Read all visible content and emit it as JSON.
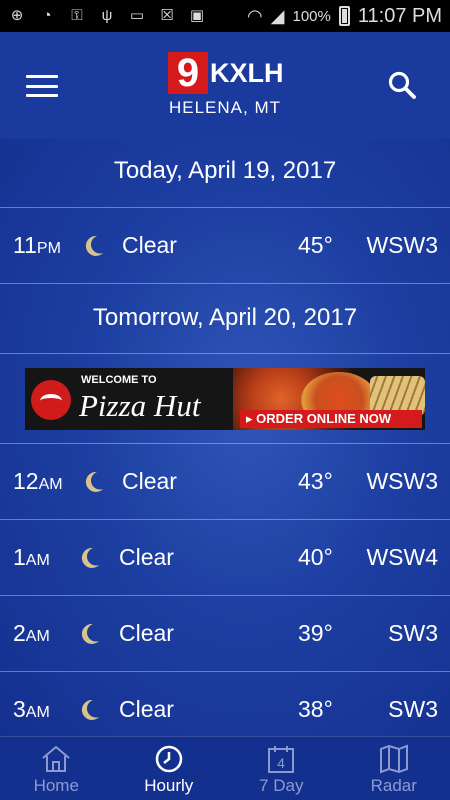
{
  "status_bar": {
    "battery": "100%",
    "time": "11:07 PM"
  },
  "header": {
    "logo_number": "9",
    "logo_text": "KXLH",
    "location": "HELENA, MT"
  },
  "sections": [
    {
      "date": "Today, April 19, 2017"
    },
    {
      "date": "Tomorrow, April 20, 2017"
    }
  ],
  "rows": [
    {
      "hour": "11",
      "ampm": "PM",
      "icon": "moon-icon",
      "condition": "Clear",
      "temp": "45°",
      "wind": "WSW3"
    },
    {
      "hour": "12",
      "ampm": "AM",
      "icon": "moon-icon",
      "condition": "Clear",
      "temp": "43°",
      "wind": "WSW3"
    },
    {
      "hour": "1",
      "ampm": "AM",
      "icon": "moon-icon",
      "condition": "Clear",
      "temp": "40°",
      "wind": "WSW4"
    },
    {
      "hour": "2",
      "ampm": "AM",
      "icon": "moon-icon",
      "condition": "Clear",
      "temp": "39°",
      "wind": "SW3"
    },
    {
      "hour": "3",
      "ampm": "AM",
      "icon": "moon-icon",
      "condition": "Clear",
      "temp": "38°",
      "wind": "SW3"
    }
  ],
  "ad": {
    "welcome": "WELCOME TO",
    "brand": "Pizza Hut",
    "cta": "▸ ORDER ONLINE NOW"
  },
  "nav": [
    {
      "label": "Home",
      "icon": "home-icon"
    },
    {
      "label": "Hourly",
      "icon": "clock-icon",
      "active": true
    },
    {
      "label": "7 Day",
      "icon": "calendar-icon",
      "calendar_day": "4"
    },
    {
      "label": "Radar",
      "icon": "map-icon"
    }
  ],
  "colors": {
    "background": "#1b3a9e",
    "logo_red": "#d41a1a",
    "moon": "#d8c48a",
    "nav_inactive": "#8c9ad0"
  }
}
